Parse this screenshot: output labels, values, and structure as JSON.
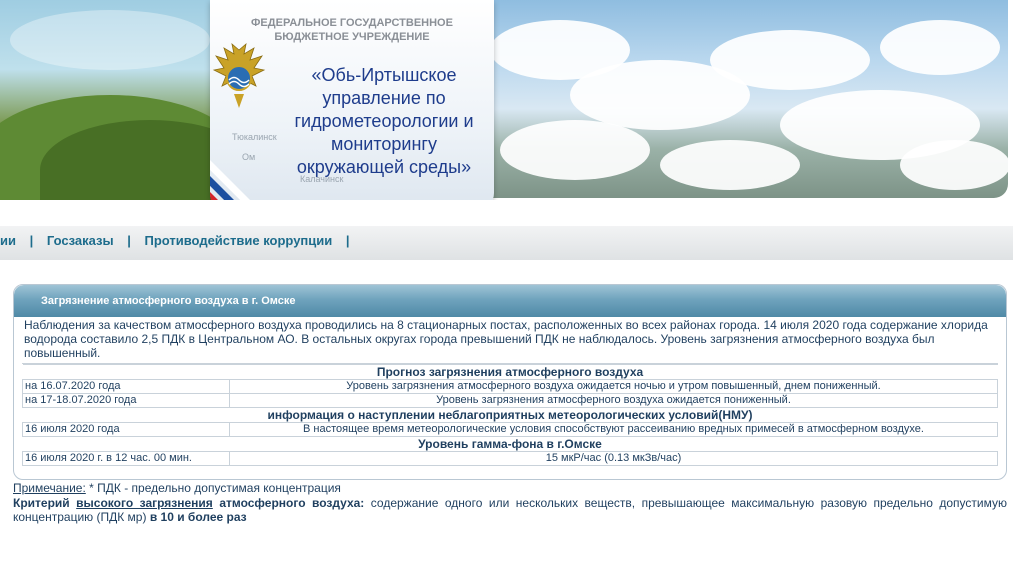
{
  "header": {
    "org_type_line1": "ФЕДЕРАЛЬНОЕ ГОСУДАРСТВЕННОЕ",
    "org_type_line2": "БЮДЖЕТНОЕ УЧРЕЖДЕНИЕ",
    "org_name": "«Обь-Иртышское управление по гидрометеорологии и мониторингу окружающей среды»",
    "map_labels": [
      "Тюкалинск",
      "Ом",
      "Калачинск"
    ]
  },
  "nav": {
    "items": [
      "ии",
      "Госзаказы",
      "Противодействие коррупции"
    ],
    "separator": "|"
  },
  "panel": {
    "title": "Загрязнение атмосферного воздуха в г. Омске",
    "intro": "Наблюдения за качеством атмосферного воздуха проводились на 8 стационарных постах, расположенных во всех районах города. 14 июля 2020 года содержание хлорида водорода составило 2,5 ПДК в Центральном АО. В остальных округах города превышений ПДК не наблюдалось. Уровень загрязнения атмосферного воздуха был повышенный.",
    "sections": [
      {
        "heading": "Прогноз загрязнения атмосферного воздуха",
        "rows": [
          {
            "date": "на 16.07.2020 года",
            "value": "Уровень загрязнения атмосферного воздуха ожидается ночью и утром повышенный, днем пониженный."
          },
          {
            "date": "на 17-18.07.2020 года",
            "value": "Уровень загрязнения атмосферного воздуха ожидается пониженный."
          }
        ]
      },
      {
        "heading": "информация о наступлении неблагоприятных метеорологических условий(НМУ)",
        "rows": [
          {
            "date": "16 июля 2020 года",
            "value": "В настоящее время метеорологические условия способствуют рассеиванию вредных примесей в атмосферном воздухе."
          }
        ]
      },
      {
        "heading": "Уровень гамма-фона в г.Омске",
        "rows": [
          {
            "date": "16 июля 2020 г. в 12 час. 00 мин.",
            "value": "15 мкР/час (0.13 мкЗв/час)"
          }
        ]
      }
    ]
  },
  "notes": {
    "note_label": "Примечание:",
    "note_text": " * ПДК - предельно допустимая концентрация",
    "criteria_label": "Критерий",
    "criteria_link": "высокого загрязнения",
    "criteria_label2": "атмосферного воздуха:",
    "criteria_text": " содержание одного или нескольких веществ, превышающее максимальную разовую предельно допустимую концентрацию (ПДК мр) ",
    "criteria_bold_end": "в 10 и более раз"
  },
  "colors": {
    "nav_text": "#1d6c8c",
    "panel_header": "#4f89a6",
    "org_name": "#1e3c8c",
    "flag_white": "#ffffff",
    "flag_blue": "#1c4fa0",
    "flag_red": "#d3232a"
  }
}
